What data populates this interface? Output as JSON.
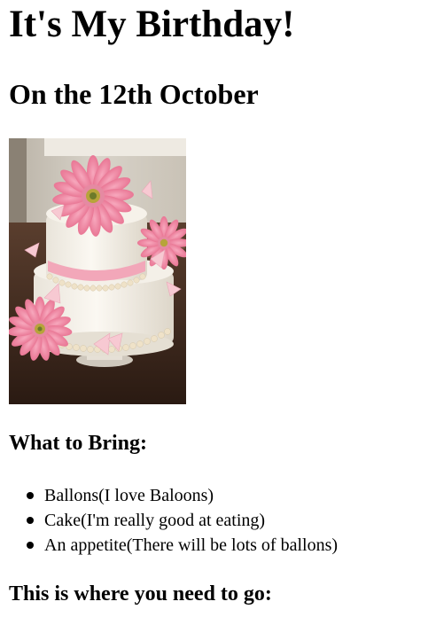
{
  "page": {
    "title": "It's My Birthday!",
    "subtitle": "On the 12th October",
    "photo_icon": "birthday-cake-photo",
    "bring_heading": "What to Bring:",
    "bring_items": [
      "Ballons(I love Baloons)",
      "Cake(I'm really good at eating)",
      "An appetite(There will be lots of ballons)"
    ],
    "directions_heading": "This is where you need to go:"
  },
  "colors": {
    "text": "#000000",
    "background": "#ffffff"
  }
}
